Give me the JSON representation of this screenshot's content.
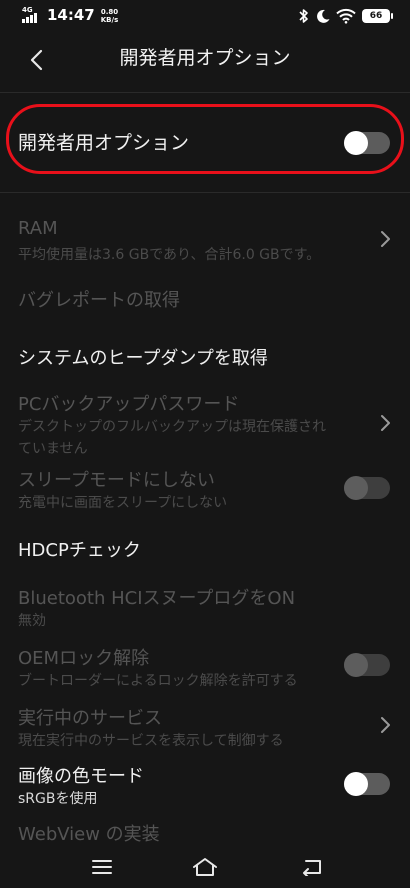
{
  "status_bar": {
    "network_type": "4G",
    "time": "14:47",
    "net_speed_value": "0.80",
    "net_speed_unit": "KB/s",
    "battery_level": "66",
    "icons": [
      "signal-icon",
      "bluetooth-icon",
      "moon-icon",
      "wifi-icon",
      "battery-icon"
    ]
  },
  "header": {
    "title": "開発者用オプション",
    "back_icon": "back-arrow-icon"
  },
  "master": {
    "label": "開発者用オプション",
    "toggle_state": "off",
    "highlight_color": "#e8101a"
  },
  "settings": {
    "ram": {
      "title": "RAM",
      "subtitle": "平均使用量は3.6 GBであり、合計6.0 GBです。",
      "enabled": false
    },
    "bug_report": {
      "title": "バグレポートの取得",
      "enabled": false
    },
    "heap_dump": {
      "title": "システムのヒープダンプを取得",
      "enabled": true
    },
    "pc_backup": {
      "title": "PCバックアップパスワード",
      "subtitle_line1": "デスクトップのフルバックアップは現在保護され",
      "subtitle_line2": "ていません",
      "enabled": false
    },
    "stay_awake": {
      "title": "スリープモードにしない",
      "subtitle": "充電中に画面をスリープにしない",
      "enabled": false,
      "toggle_state": "off"
    },
    "hdcp": {
      "title": "HDCPチェック",
      "enabled": true
    },
    "bt_hci": {
      "title": "Bluetooth HCIスヌープログをON",
      "subtitle": "無効",
      "enabled": false
    },
    "oem_unlock": {
      "title": "OEMロック解除",
      "subtitle": "ブートローダーによるロック解除を許可する",
      "enabled": false,
      "toggle_state": "off"
    },
    "running_services": {
      "title": "実行中のサービス",
      "subtitle": "現在実行中のサービスを表示して制御する",
      "enabled": false
    },
    "color_mode": {
      "title": "画像の色モード",
      "subtitle": "sRGBを使用",
      "enabled": true,
      "toggle_state": "off"
    },
    "webview": {
      "title": "WebView の実装",
      "enabled": false
    }
  },
  "nav_bar": {
    "icons": [
      "menu-icon",
      "home-icon",
      "back-icon"
    ]
  },
  "colors": {
    "background": "#161616",
    "text_enabled": "#f0f0f0",
    "text_disabled": "#555555"
  }
}
